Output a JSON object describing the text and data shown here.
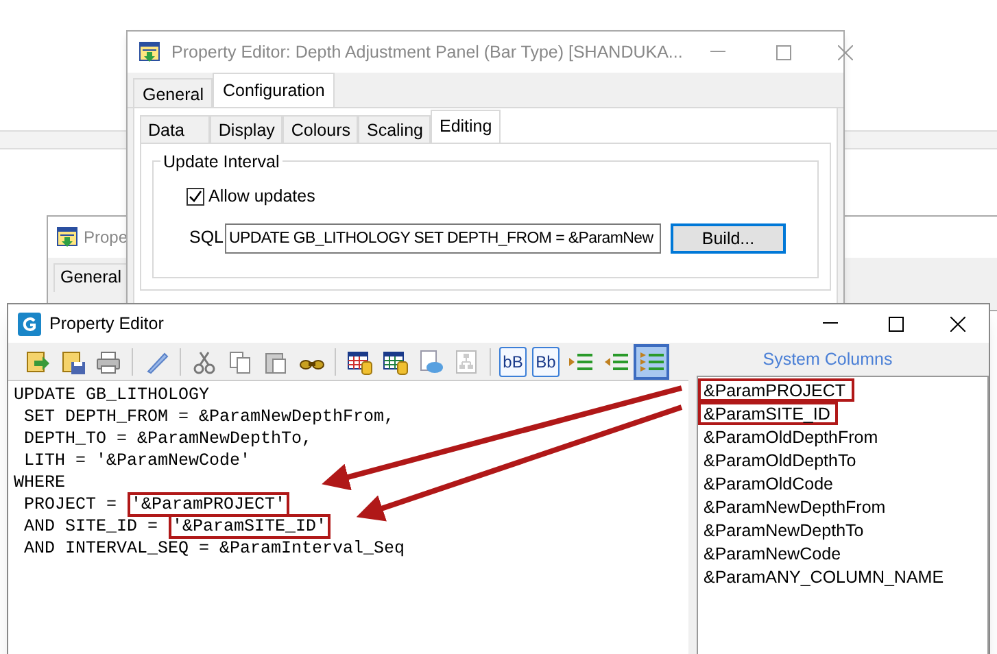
{
  "config_window": {
    "title": "Property Editor: Depth Adjustment Panel (Bar Type) [SHANDUKA...",
    "tabs": [
      {
        "label": "General",
        "selected": false
      },
      {
        "label": "Configuration",
        "selected": true
      }
    ],
    "subtabs": [
      {
        "label": "Data",
        "selected": false
      },
      {
        "label": "Display",
        "selected": false
      },
      {
        "label": "Colours",
        "selected": false
      },
      {
        "label": "Scaling",
        "selected": false
      },
      {
        "label": "Editing",
        "selected": true
      }
    ],
    "group": {
      "title": "Update Interval",
      "allow_updates": {
        "label": "Allow updates",
        "checked": true
      },
      "sql": {
        "label": "SQL",
        "value": "UPDATE GB_LITHOLOGY SET DEPTH_FROM = &ParamNew"
      },
      "build_button": "Build..."
    }
  },
  "back_window": {
    "title": "Prope",
    "tab": "General"
  },
  "editor_window": {
    "title": "Property Editor",
    "toolbar": [
      {
        "kind": "open",
        "selected": false
      },
      {
        "kind": "save",
        "selected": false
      },
      {
        "kind": "print",
        "selected": false
      },
      {
        "kind": "separator"
      },
      {
        "kind": "pen",
        "selected": false
      },
      {
        "kind": "separator"
      },
      {
        "kind": "cut",
        "selected": false
      },
      {
        "kind": "copy",
        "selected": false
      },
      {
        "kind": "paste",
        "selected": false
      },
      {
        "kind": "binoculars",
        "selected": false
      },
      {
        "kind": "separator"
      },
      {
        "kind": "grid-red",
        "selected": false
      },
      {
        "kind": "grid-green",
        "selected": false
      },
      {
        "kind": "comment",
        "selected": false
      },
      {
        "kind": "tree",
        "selected": false
      },
      {
        "kind": "separator"
      },
      {
        "kind": "case",
        "label": "bB",
        "selected": false
      },
      {
        "kind": "case",
        "label": "Bb",
        "selected": false
      },
      {
        "kind": "indent",
        "selected": false
      },
      {
        "kind": "outdent",
        "selected": false
      },
      {
        "kind": "align",
        "selected": true
      }
    ],
    "sql_lines": [
      {
        "segments": [
          {
            "text": "UPDATE GB_LITHOLOGY",
            "highlighted": false
          }
        ]
      },
      {
        "segments": [
          {
            "text": " SET DEPTH_FROM = &ParamNewDepthFrom,",
            "highlighted": false
          }
        ]
      },
      {
        "segments": [
          {
            "text": " DEPTH_TO = &ParamNewDepthTo,",
            "highlighted": false
          }
        ]
      },
      {
        "segments": [
          {
            "text": " LITH = '&ParamNewCode'",
            "highlighted": false
          }
        ]
      },
      {
        "segments": [
          {
            "text": "WHERE",
            "highlighted": false
          }
        ]
      },
      {
        "segments": [
          {
            "text": " PROJECT = ",
            "highlighted": false
          },
          {
            "text": "'&ParamPROJECT'",
            "highlighted": true
          }
        ]
      },
      {
        "segments": [
          {
            "text": " AND SITE_ID = ",
            "highlighted": false
          },
          {
            "text": "'&ParamSITE_ID'",
            "highlighted": true
          }
        ]
      },
      {
        "segments": [
          {
            "text": " AND INTERVAL_SEQ = &ParamInterval_Seq",
            "highlighted": false
          }
        ]
      }
    ],
    "system_columns": {
      "title": "System Columns",
      "items": [
        {
          "text": "&ParamPROJECT",
          "highlighted": true
        },
        {
          "text": "&ParamSITE_ID",
          "highlighted": true
        },
        {
          "text": "&ParamOldDepthFrom",
          "highlighted": false
        },
        {
          "text": "&ParamOldDepthTo",
          "highlighted": false
        },
        {
          "text": "&ParamOldCode",
          "highlighted": false
        },
        {
          "text": "&ParamNewDepthFrom",
          "highlighted": false
        },
        {
          "text": "&ParamNewDepthTo",
          "highlighted": false
        },
        {
          "text": "&ParamNewCode",
          "highlighted": false
        },
        {
          "text": "&ParamANY_COLUMN_NAME",
          "highlighted": false
        }
      ]
    }
  }
}
